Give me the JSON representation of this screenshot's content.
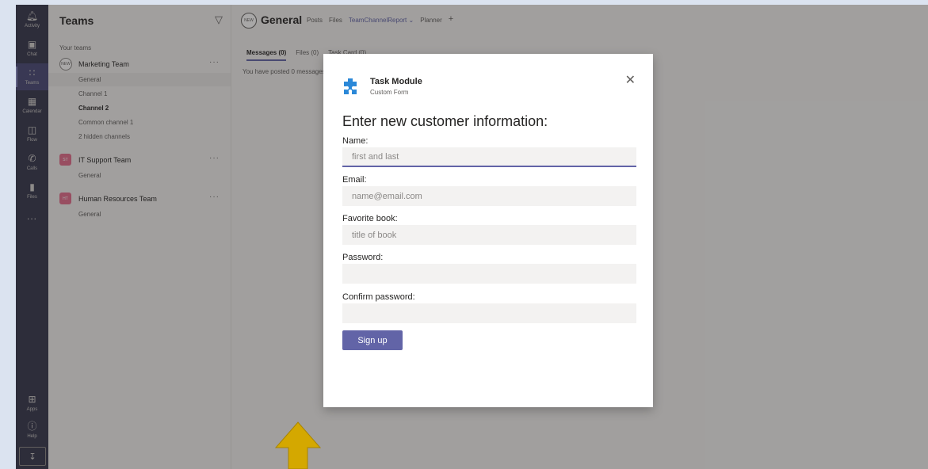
{
  "rail": {
    "items": [
      {
        "label": "Activity",
        "icon": "bell-icon"
      },
      {
        "label": "Chat",
        "icon": "chat-icon"
      },
      {
        "label": "Teams",
        "icon": "teams-icon"
      },
      {
        "label": "Calendar",
        "icon": "calendar-icon"
      },
      {
        "label": "Flow",
        "icon": "flow-icon"
      },
      {
        "label": "Calls",
        "icon": "phone-icon"
      },
      {
        "label": "Files",
        "icon": "file-icon"
      }
    ],
    "more": "...",
    "apps": "Apps",
    "help": "Help"
  },
  "teams_pane": {
    "title": "Teams",
    "section": "Your teams",
    "teams": [
      {
        "name": "Marketing Team",
        "avatar": "NEW",
        "color": "#ffffff",
        "channels": [
          "General",
          "Channel 1",
          "Channel 2",
          "Common channel 1",
          "2 hidden channels"
        ]
      },
      {
        "name": "IT Support Team",
        "avatar": "ST",
        "color": "#e56b8a",
        "channels": [
          "General"
        ]
      },
      {
        "name": "Human Resources Team",
        "avatar": "HT",
        "color": "#e56b8a",
        "channels": [
          "General"
        ]
      }
    ]
  },
  "main": {
    "channel_badge": "NEW",
    "channel_title": "General",
    "tabs": [
      "Posts",
      "Files",
      "TeamChannelReport",
      "Planner"
    ],
    "sub_tabs": [
      "Messages (0)",
      "Files (0)",
      "Task Card (0)"
    ],
    "posted_text": "You have posted 0 messages"
  },
  "dialog": {
    "title": "Task Module",
    "subtitle": "Custom Form",
    "heading": "Enter new customer information:",
    "fields": [
      {
        "label": "Name:",
        "placeholder": "first and last"
      },
      {
        "label": "Email:",
        "placeholder": "name@email.com"
      },
      {
        "label": "Favorite book:",
        "placeholder": "title of book"
      },
      {
        "label": "Password:",
        "placeholder": ""
      },
      {
        "label": "Confirm password:",
        "placeholder": ""
      }
    ],
    "submit_label": "Sign up"
  },
  "colors": {
    "accent": "#6264a7",
    "rail": "#33344a",
    "arrow": "#d4a800"
  }
}
